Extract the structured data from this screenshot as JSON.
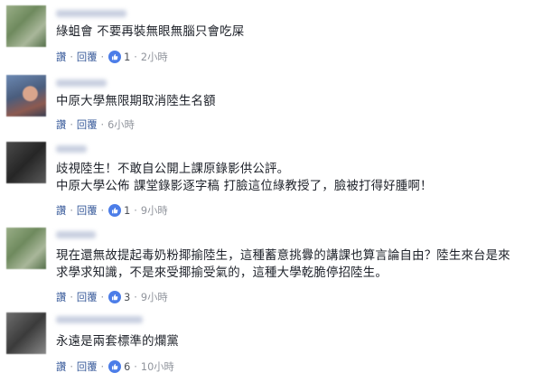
{
  "comments": [
    {
      "text_lines": [
        "綠蛆會 不要再裝無眼無腦只會吃屎"
      ],
      "actions": {
        "reply_label": "讚",
        "reply2_label": "回覆",
        "like_count": "1",
        "time": "2小時"
      }
    },
    {
      "text_lines": [
        "中原大學無限期取消陸生名額"
      ],
      "actions": {
        "reply_label": "讚",
        "reply2_label": "回覆",
        "like_count": "",
        "time": "6小時"
      }
    },
    {
      "text_lines": [
        "歧視陸生！不敢自公開上課原錄影供公評。",
        "中原大學公佈 課堂錄影逐字稿 打臉這位綠教授了，臉被打得好腫啊！"
      ],
      "actions": {
        "reply_label": "讚",
        "reply2_label": "回覆",
        "like_count": "1",
        "time": "9小時"
      }
    },
    {
      "text_lines": [
        "現在還無故提起毒奶粉揶揄陸生，這種蓄意挑釁的講課也算言論自由？陸生來台是來",
        "求學求知識，不是來受揶揄受氣的，這種大學乾脆停招陸生。"
      ],
      "actions": {
        "reply_label": "讚",
        "reply2_label": "回覆",
        "like_count": "3",
        "time": "9小時"
      }
    },
    {
      "text_lines": [
        "永遠是兩套標準的爛黨"
      ],
      "actions": {
        "reply_label": "讚",
        "reply2_label": "回覆",
        "like_count": "6",
        "time": "10小時"
      }
    }
  ],
  "colors": {
    "link": "#365899",
    "meta": "#90949c",
    "like": "#4c7de8",
    "text": "#1d2129"
  },
  "icons": {
    "like": "thumbs-up-icon"
  }
}
